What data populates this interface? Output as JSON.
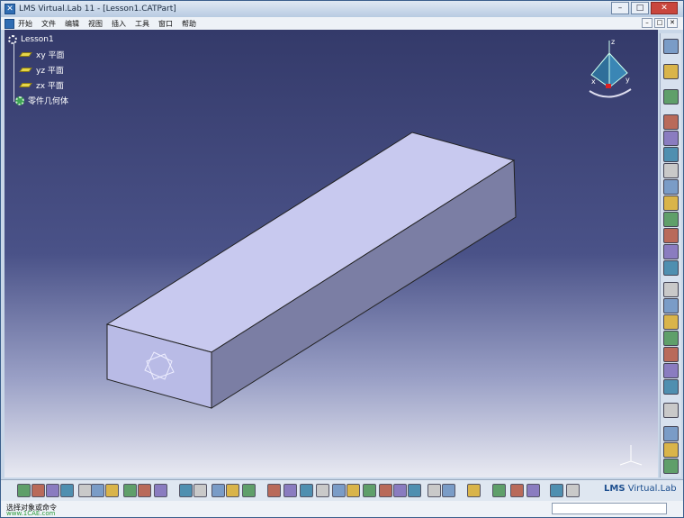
{
  "window": {
    "title": "LMS Virtual.Lab 11 - [Lesson1.CATPart]"
  },
  "window_controls": {
    "minimize": "–",
    "maximize": "□",
    "close": "✕"
  },
  "menu": {
    "items": [
      "开始",
      "文件",
      "编辑",
      "视图",
      "插入",
      "工具",
      "窗口",
      "帮助"
    ]
  },
  "tree": {
    "root": "Lesson1",
    "items": [
      {
        "label": "xy 平面",
        "icon": "plane-icon"
      },
      {
        "label": "yz 平面",
        "icon": "plane-icon"
      },
      {
        "label": "zx 平面",
        "icon": "plane-icon"
      },
      {
        "label": "零件几何体",
        "icon": "gear-icon"
      }
    ]
  },
  "compass": {
    "x": "x",
    "y": "y",
    "z": "z"
  },
  "brand": {
    "text": "LMS",
    "suffix": " Virtual.Lab"
  },
  "status": {
    "text": "选择对象或命令",
    "watermark": "www.1CAE.com"
  },
  "colors": {
    "viewport_top": "#343a6a",
    "viewport_bottom": "#e9eaf2",
    "part_top": "#c8c9ef",
    "part_front": "#b9bbe6",
    "part_side": "#7b7ea4"
  },
  "right_toolbar_icons": [
    "sketch-icon",
    "selection-icon",
    "sketcher-icon",
    "pad-icon",
    "pocket-icon",
    "shaft-icon",
    "groove-icon",
    "hole-icon",
    "rib-icon",
    "slot-icon",
    "stiffener-icon",
    "solid-combine-icon",
    "fillet-icon",
    "chamfer-icon",
    "draft-icon",
    "shell-icon",
    "thickness-icon",
    "thread-icon",
    "remove-face-icon",
    "replace-face-icon",
    "translation-icon",
    "mirror-icon",
    "pattern-icon",
    "scaling-icon",
    "assemble-icon"
  ],
  "bottom_toolbar_icons": [
    "new-icon",
    "open-icon",
    "save-icon",
    "print-icon",
    "cut-icon",
    "copy-icon",
    "paste-icon",
    "undo-icon",
    "redo-icon",
    "whats-this-icon",
    "formula-icon",
    "comment-icon",
    "table-icon",
    "catalog-icon",
    "measure-icon",
    "fly-mode-icon",
    "fit-all-icon",
    "pan-icon",
    "rotate-icon",
    "zoom-in-icon",
    "zoom-out-icon",
    "normal-view-icon",
    "iso-view-icon",
    "shading-icon",
    "hide-show-icon",
    "swap-icon",
    "texture-icon",
    "apply-material-icon",
    "measure-item-icon",
    "construction-icon",
    "tools-icon",
    "update-icon",
    "analysis-icon"
  ]
}
